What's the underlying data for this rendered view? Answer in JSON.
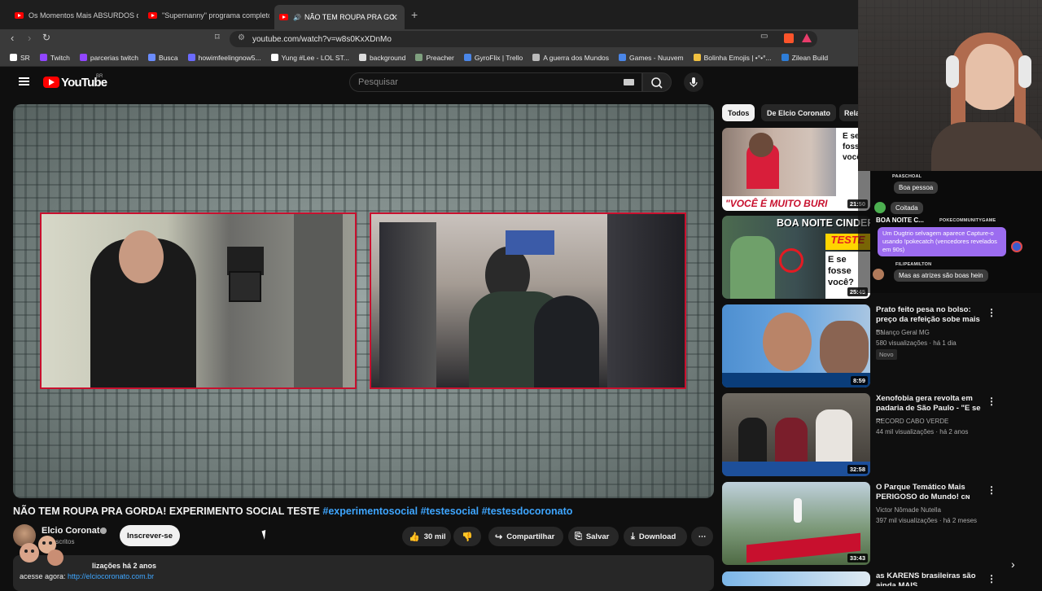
{
  "browser": {
    "tabs": [
      {
        "title": "Os Momentos Mais ABSURDOS do E..."
      },
      {
        "title": "\"Supernanny\" programa completo - ..."
      },
      {
        "title": "NÃO TEM ROUPA PRA GORDA..."
      }
    ],
    "url": "youtube.com/watch?v=w8s0KxXDnMo",
    "bookmarks": [
      "SR",
      "Twitch",
      "parcerias twitch",
      "Busca",
      "howimfeelingnow5...",
      "Yung #Lee - LOL ST...",
      "background",
      "Preacher",
      "GyroFlix | Trello",
      "A guerra dos Mundos",
      "Games - Nuuvem",
      "Bolinha Emojis | •°•°...",
      "Zilean Build"
    ],
    "bookmark_colors": [
      "#ffffff",
      "#9146ff",
      "#9146ff",
      "#6b8cff",
      "#6b6bff",
      "#ffffff",
      "#dddddd",
      "#7fa07f",
      "#4a86e8",
      "#bbbbbb",
      "#4a86e8",
      "#f0c040",
      "#2e7dd7"
    ]
  },
  "youtube": {
    "logo_text": "YouTube",
    "country": "BR",
    "search_placeholder": "Pesquisar",
    "video": {
      "title": "NÃO TEM ROUPA PRA GORDA! EXPERIMENTO SOCIAL TESTE",
      "hashtags": "#experimentosocial #testesocial #testesdocoronato",
      "channel": "Elcio Coronato",
      "subscribers": "de inscritos",
      "subscribe_label": "Inscrever-se",
      "likes": "30 mil",
      "share_label": "Compartilhar",
      "save_label": "Salvar",
      "download_label": "Download",
      "desc_meta": "lizações  há 2 anos",
      "desc_prefix": "acesse agora: ",
      "desc_link": "http://elciocoronato.com.br"
    },
    "chips": [
      "Todos",
      "De Elcio Coronato",
      "Rela"
    ],
    "recommendations": [
      {
        "duration": "21:50",
        "thumb_text": "\"VOCÊ É MUITO BURI",
        "side_text": "E se fosse você"
      },
      {
        "duration": "25:45",
        "thumb_text": "BOA NOITE CINDERELA",
        "tag1": "TESTE",
        "tag2": "E se fosse você?"
      },
      {
        "duration": "8:59",
        "title": "Prato feito pesa no bolso: preço da refeição sobe mais ...",
        "channel": "Balanço Geral MG",
        "meta": "580 visualizações · há 1 dia",
        "badge": "Novo"
      },
      {
        "duration": "32:58",
        "title": "Xenofobia gera revolta em padaria de São Paulo - \"E se ...",
        "channel": "RECORD CABO VERDE",
        "meta": "44 mil visualizações · há 2 anos"
      },
      {
        "duration": "33:43",
        "title": "O Parque Temático Mais PERIGOSO do Mundo! ᴄɴ",
        "channel": "Victor Nômade Nutella",
        "meta": "397 mil visualizações · há 2 meses"
      },
      {
        "title": "as KARENS brasileiras são ainda MAIS INSUPORTÁVEIS"
      }
    ]
  },
  "chat": {
    "messages": [
      {
        "user": "PAASCHOAL",
        "text": "Boa pessoa"
      },
      {
        "user": "",
        "text": "Coitada"
      },
      {
        "user": "BOA NOITE C...",
        "text": "",
        "system": "POKECOMMUNITYGAME"
      },
      {
        "user": "",
        "text": "Um Dugtrio selvagem aparece Capture-o usando !pokecatch (vencedores revelados em 90s)"
      },
      {
        "user": "FILIPEAMILTON",
        "text": "Mas as atrizes são boas hein"
      }
    ]
  },
  "colors": {
    "accent_red": "#ff0000",
    "link_blue": "#3ea6ff",
    "frame_red": "#c8102e",
    "chat_purple": "#9c6cf0"
  }
}
